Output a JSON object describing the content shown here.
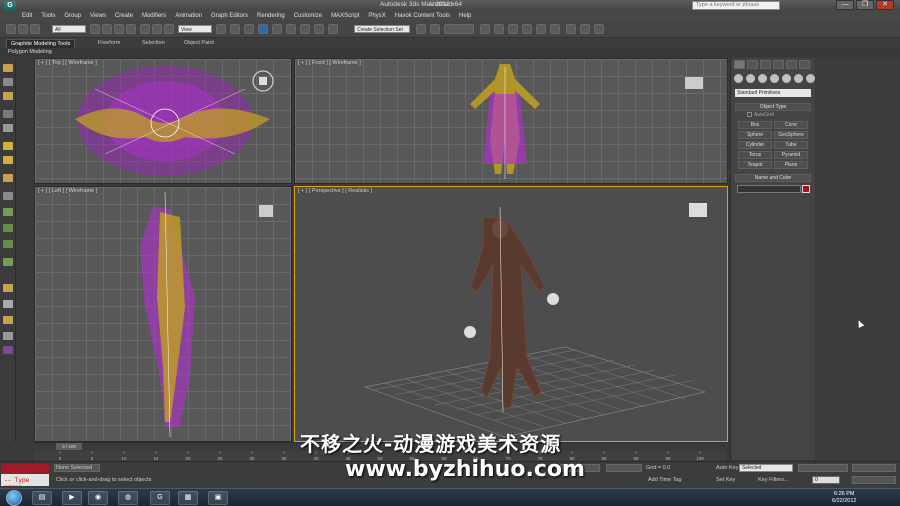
{
  "window": {
    "app_title": "Autodesk 3ds Max 2012 x64",
    "document": "Untitled",
    "search_placeholder": "Type a keyword or phrase",
    "buttons": [
      "—",
      "❐",
      "✕"
    ]
  },
  "menu": [
    "Edit",
    "Tools",
    "Group",
    "Views",
    "Create",
    "Modifiers",
    "Animation",
    "Graph Editors",
    "Rendering",
    "Customize",
    "MAXScript",
    "PhysX",
    "Havok Content Tools",
    "Help"
  ],
  "toolbar": {
    "selection_filter": "All",
    "coord_system": "View",
    "named_selection": "Create Selection Set"
  },
  "ribbon": {
    "tabs": [
      "Graphite Modeling Tools",
      "Freeform",
      "Selection",
      "Object Paint"
    ],
    "sub_label": "Polygon Modeling"
  },
  "viewports": {
    "top": "[ + ] [ Top ] [ Wireframe ]",
    "front": "[ + ] [ Front ] [ Wireframe ]",
    "left": "[ + ] [ Left ] [ Wireframe ]",
    "perspective": "[ + ] [ Perspective ] [ Realistic ]"
  },
  "command_panel": {
    "category": "Standard Primitives",
    "object_type_title": "Object Type",
    "autogrid_label": "AutoGrid",
    "primitives": [
      "Box",
      "Cone",
      "Sphere",
      "GeoSphere",
      "Cylinder",
      "Tube",
      "Torus",
      "Pyramid",
      "Teapot",
      "Plane"
    ],
    "name_color_title": "Name and Color",
    "swatch_color": "#a8102a"
  },
  "timeline": {
    "frame_display": "0 / 100",
    "ticks": [
      "0",
      "5",
      "10",
      "15",
      "20",
      "25",
      "30",
      "35",
      "40",
      "45",
      "50",
      "55",
      "60",
      "65",
      "70",
      "75",
      "80",
      "85",
      "90",
      "95",
      "100"
    ]
  },
  "statusbar": {
    "maxscript_text": "-- Type error",
    "selection_status": "None Selected",
    "prompt": "Click or click-and-drag to select objects",
    "grid": "Grid = 0.0",
    "auto_key": "Auto Key",
    "set_key": "Set Key",
    "key_mode": "Selected",
    "key_filters": "Key Filters...",
    "add_time_tag": "Add Time Tag",
    "frame_value": "0"
  },
  "taskbar": {
    "time": "6:26 PM",
    "date": "6/22/2012",
    "apps": [
      "explorer-icon",
      "media-player-icon",
      "chrome-icon",
      "firefox-icon",
      "3dsmax-icon",
      "film-icon",
      "app-icon"
    ]
  },
  "watermark": {
    "line1": "不移之火-动漫游戏美术资源",
    "line2": "www.byzhihuo.com"
  }
}
